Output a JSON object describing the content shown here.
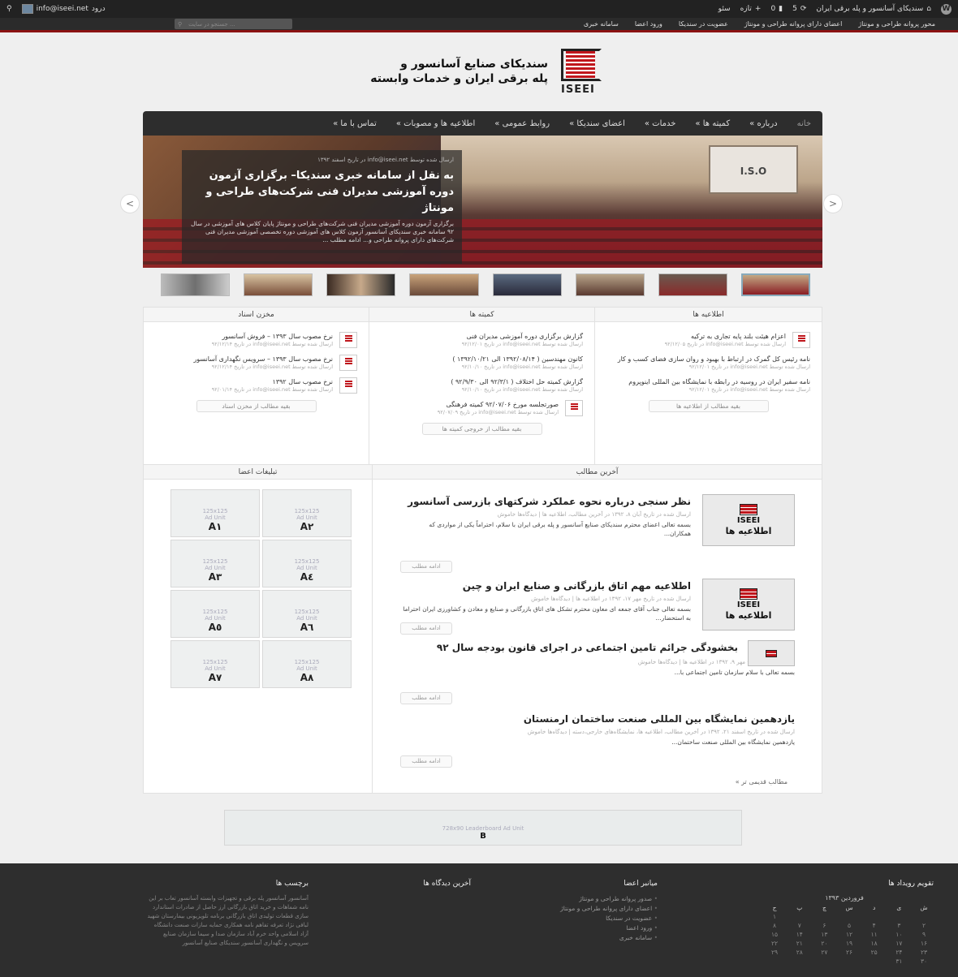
{
  "adminbar": {
    "site_title": "سندیکای آسانسور و پله برقی ایران",
    "updates": "5",
    "comments": "0",
    "new_label": "تازه",
    "seo_label": "سئو",
    "user_label": "info@iseei.net",
    "logout_label": "درود"
  },
  "topbar": {
    "menu": [
      "محور پروانه طراحی و مونتاژ",
      "اعضای دارای پروانه طراحی و مونتاژ",
      "عضویت در سندیکا",
      "ورود اعضا",
      "سامانه خبری"
    ],
    "search_placeholder": "جستجو در سایت ..."
  },
  "logo": {
    "mark_text": "ISEEI",
    "line1": "سندیکای صنایع آسانسور و",
    "line2": "پله برقی ایران و خدمات وابسته"
  },
  "nav": {
    "items": [
      "خانه",
      "درباره »",
      "کمیته ها »",
      "خدمات »",
      "اعضای سندیکا »",
      "روابط عمومی »",
      "اطلاعیه ها و مصوبات »",
      "تماس با ما »"
    ]
  },
  "slider": {
    "meta": "ارسال شده توسط info@iseei.net در تاریخ اسفند ۱۳۹۲",
    "headline": "به نقل از سامانه خبری سندیکا– برگزاری آزمون دوره آموزشی مدیران فنی شرکت‌های طراحی و مونتاژ",
    "excerpt": "برگزاری آزمون دوره آموزشی مدیران فنی شرکت‌های طراحی و مونتاژ پایان کلاس های آموزشی در سال ۹۲ سامانه خبری سندیکای آسانسور آزمون کلاس های آموزشی دوره تخصصی آموزشی مدیران فنی شرکت‌های دارای پروانه طراحی و... ادامه مطلب ...",
    "screen_text": "I.S.O",
    "prev": "<",
    "next": ">"
  },
  "columns": {
    "announcements": {
      "title": "اطلاعیه ها",
      "items": [
        {
          "title": "اعزام هیئت بلند پایه تجاری به ترکیه",
          "meta": "ارسال شده توسط info@iseei.net در تاریخ ۹۲/۱۲/۰۵"
        },
        {
          "title": "نامه رئیس کل گمرک در ارتباط با بهبود و روان سازی فضای کسب و کار",
          "meta": "ارسال شده توسط info@iseei.net در تاریخ ۹۲/۱۲/۰۱"
        },
        {
          "title": "نامه سفیر ایران در روسیه در رابطه با نمایشگاه بین المللی اینوپروم",
          "meta": "ارسال شده توسط info@iseei.net در تاریخ ۹۲/۱۲/۰۱"
        }
      ],
      "more": "بقیه مطالب از اطلاعیه ها"
    },
    "committees": {
      "title": "کمیته ها",
      "items": [
        {
          "title": "گزارش برگزاری دوره آموزشی مدیران فنی",
          "meta": "ارسال شده توسط info@iseei.net در تاریخ ۹۲/۱۲/۰۱"
        },
        {
          "title": "کانون مهندسین ( ۱۳۹۲/۰۸/۱۴ الی ۱۳۹۲/۱۰/۲۱ )",
          "meta": "ارسال شده توسط info@iseei.net در تاریخ ۹۲/۱۰/۱۰"
        },
        {
          "title": "گزارش کمیته حل اختلاف ( ۹۲/۳/۱ الی ۹۲/۹/۳۰ )",
          "meta": "ارسال شده توسط info@iseei.net در تاریخ ۹۲/۱۰/۱۰"
        },
        {
          "title": "صورتجلسه مورخ ۹۲/۰۷/۰۶ کمیته فرهنگی",
          "meta": "ارسال شده توسط info@iseei.net در تاریخ ۹۲/۰۷/۰۹"
        }
      ],
      "more": "بقیه مطالب از خروجی کمیته ها"
    },
    "documents": {
      "title": "مخزن اسناد",
      "items": [
        {
          "title": "نرخ مصوب سال ۱۳۹۳ – فروش آسانسور",
          "meta": "ارسال شده توسط info@iseei.net در تاریخ ۹۲/۱۲/۱۴"
        },
        {
          "title": "نرخ مصوب سال ۱۳۹۳ – سرویس نگهداری آسانسور",
          "meta": "ارسال شده توسط info@iseei.net در تاریخ ۹۲/۱۲/۱۴"
        },
        {
          "title": "نرخ مصوب سال ۱۳۹۲",
          "meta": "ارسال شده توسط info@iseei.net در تاریخ ۹۲/۰۱/۱۴"
        }
      ],
      "more": "بقیه مطالب از مخزن اسناد"
    }
  },
  "ads": {
    "title": "تبلیغات اعضا",
    "size_label": "125x125",
    "unit_label": "Ad Unit",
    "tags": [
      "A۱",
      "A۲",
      "A۳",
      "A٤",
      "A٥",
      "A٦",
      "A۷",
      "A۸"
    ]
  },
  "latest": {
    "title": "آخرین مطالب",
    "img_brand": "ISEEI",
    "img_cat": "اطلاعیه ها",
    "read_more": "ادامه مطلب",
    "posts": [
      {
        "title": "نظر سنجی درباره نحوه عملکرد شرکتهای بازرسی آسانسور",
        "meta": "ارسال شده در تاریخ آبان ۸، ۱۳۹۲ در آخرین مطالب، اطلاعیه ها | دیدگاه‌ها خاموش",
        "excerpt": "بسمه تعالی اعضای محترم سندیکای صنایع آسانسور و پله برقی ایران با سلام، احتراماً یکی از مواردی که همکاران..."
      },
      {
        "title": "اطلاعیه مهم اتاق بازرگانی و صنایع ایران و چین",
        "meta": "ارسال شده در تاریخ مهر ۱۷، ۱۳۹۲ در اطلاعیه ها | دیدگاه‌ها خاموش",
        "excerpt": "بسمه تعالی جناب آقای جمعه ای معاون محترم تشکل های اتاق بازرگانی و صنایع و معادن و کشاورزی ایران احتراما به استحضار..."
      },
      {
        "title": "بخشودگی جرائم تامین اجتماعی در اجرای قانون بودجه سال ۹۲",
        "meta": "ارسال شده در تاریخ مهر ۹، ۱۳۹۲ در اطلاعیه ها | دیدگاه‌ها خاموش",
        "excerpt": "بسمه تعالی با سلام سازمان تامین اجتماعی با..."
      },
      {
        "title": "یازدهمین نمایشگاه بین المللی صنعت ساختمان ارمنستان",
        "meta": "ارسال شده در تاریخ اسفند ۲۱، ۱۳۹۲ در آخرین مطالب، اطلاعیه ها، نمایشگاه‌های خارجی،دسته | دیدگاه‌ها خاموش",
        "excerpt": "یازدهمین نمایشگاه بین المللی صنعت ساختمان..."
      }
    ],
    "older": "مطالب قدیمی تر »"
  },
  "leaderboard": {
    "label": "728x90 Leaderboard Ad Unit",
    "tag": "B"
  },
  "footer": {
    "calendar": {
      "title": "تقویم رویداد ها",
      "month": "فروردین ۱۳۹۳",
      "weekdays": [
        "ش",
        "ی",
        "د",
        "س",
        "چ",
        "پ",
        "ج"
      ],
      "rows": [
        [
          "",
          "",
          "",
          "",
          "",
          "",
          "۱"
        ],
        [
          "۲",
          "۳",
          "۴",
          "۵",
          "۶",
          "۷",
          "۸"
        ],
        [
          "۹",
          "۱۰",
          "۱۱",
          "۱۲",
          "۱۳",
          "۱۴",
          "۱۵"
        ],
        [
          "۱۶",
          "۱۷",
          "۱۸",
          "۱۹",
          "۲۰",
          "۲۱",
          "۲۲"
        ],
        [
          "۲۳",
          "۲۴",
          "۲۵",
          "۲۶",
          "۲۷",
          "۲۸",
          "۲۹"
        ],
        [
          "۳۰",
          "۳۱",
          "",
          "",
          "",
          "",
          ""
        ]
      ]
    },
    "shortcuts": {
      "title": "میانبر اعضا",
      "items": [
        "صدور پروانه طراحی و مونتاژ",
        "اعضای دارای پروانه طراحی و مونتاژ",
        "عضویت در سندیکا",
        "ورود اعضا",
        "سامانه خبری"
      ]
    },
    "comments": {
      "title": "آخرین دیدگاه ها"
    },
    "tags": {
      "title": "برچسب ها",
      "text": "آسانسور آسانسور پله برقی و تجهیزات وابسته آسانسور تعاب بر این نامه شماهات و خرید اتاق بازرگانی ارز حاصل از صادرات استاندارد سازی قطعات تولیدی اتاق بازرگانی برنامه تلویزیونی بیمارستان شهید لبافی نژاد تعرفه تفاهم نامه همکاری حمایه سازات صنعت دانشگاه آزاد اسلامی واحد خرم آباد سازمان صدا و سیما سازمان صنایع سرویس و نگهداری آسانسور سندیکای صنایع آسانسور"
    }
  },
  "colors": {
    "accent": "#8b1212",
    "dark": "#2d2d2d",
    "logo_red": "#c0161c"
  }
}
